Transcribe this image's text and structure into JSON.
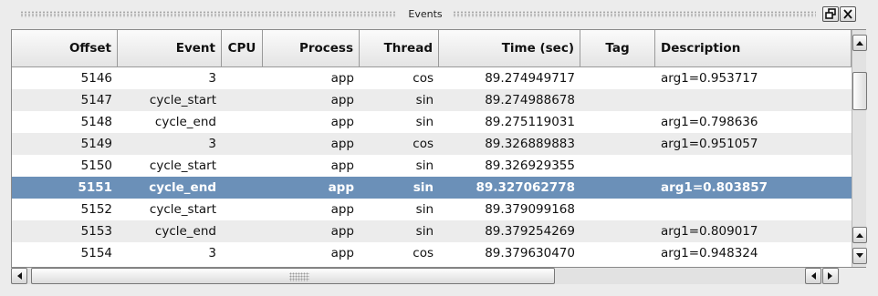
{
  "window": {
    "title": "Events"
  },
  "columns": [
    "Offset",
    "Event",
    "CPU",
    "Process",
    "Thread",
    "Time (sec)",
    "Tag",
    "Description"
  ],
  "rows": [
    {
      "offset": "5146",
      "event": "3",
      "cpu": "",
      "process": "app",
      "thread": "cos",
      "time": "89.274949717",
      "tag": "",
      "description": "arg1=0.953717"
    },
    {
      "offset": "5147",
      "event": "cycle_start",
      "cpu": "",
      "process": "app",
      "thread": "sin",
      "time": "89.274988678",
      "tag": "",
      "description": ""
    },
    {
      "offset": "5148",
      "event": "cycle_end",
      "cpu": "",
      "process": "app",
      "thread": "sin",
      "time": "89.275119031",
      "tag": "",
      "description": "arg1=0.798636"
    },
    {
      "offset": "5149",
      "event": "3",
      "cpu": "",
      "process": "app",
      "thread": "cos",
      "time": "89.326889883",
      "tag": "",
      "description": "arg1=0.951057"
    },
    {
      "offset": "5150",
      "event": "cycle_start",
      "cpu": "",
      "process": "app",
      "thread": "sin",
      "time": "89.326929355",
      "tag": "",
      "description": ""
    },
    {
      "offset": "5151",
      "event": "cycle_end",
      "cpu": "",
      "process": "app",
      "thread": "sin",
      "time": "89.327062778",
      "tag": "",
      "description": "arg1=0.803857"
    },
    {
      "offset": "5152",
      "event": "cycle_start",
      "cpu": "",
      "process": "app",
      "thread": "sin",
      "time": "89.379099168",
      "tag": "",
      "description": ""
    },
    {
      "offset": "5153",
      "event": "cycle_end",
      "cpu": "",
      "process": "app",
      "thread": "sin",
      "time": "89.379254269",
      "tag": "",
      "description": "arg1=0.809017"
    },
    {
      "offset": "5154",
      "event": "3",
      "cpu": "",
      "process": "app",
      "thread": "cos",
      "time": "89.379630470",
      "tag": "",
      "description": "arg1=0.948324"
    }
  ],
  "selected_row": 5,
  "colors": {
    "selection": "#6b90b8",
    "alt_row": "#ececec",
    "header": "#e4e4e4"
  },
  "icons": {
    "float": "float-window-icon",
    "close": "close-icon",
    "scroll_up": "arrow-up-icon",
    "scroll_down": "arrow-down-icon",
    "scroll_left": "arrow-left-icon",
    "scroll_right": "arrow-right-icon"
  }
}
